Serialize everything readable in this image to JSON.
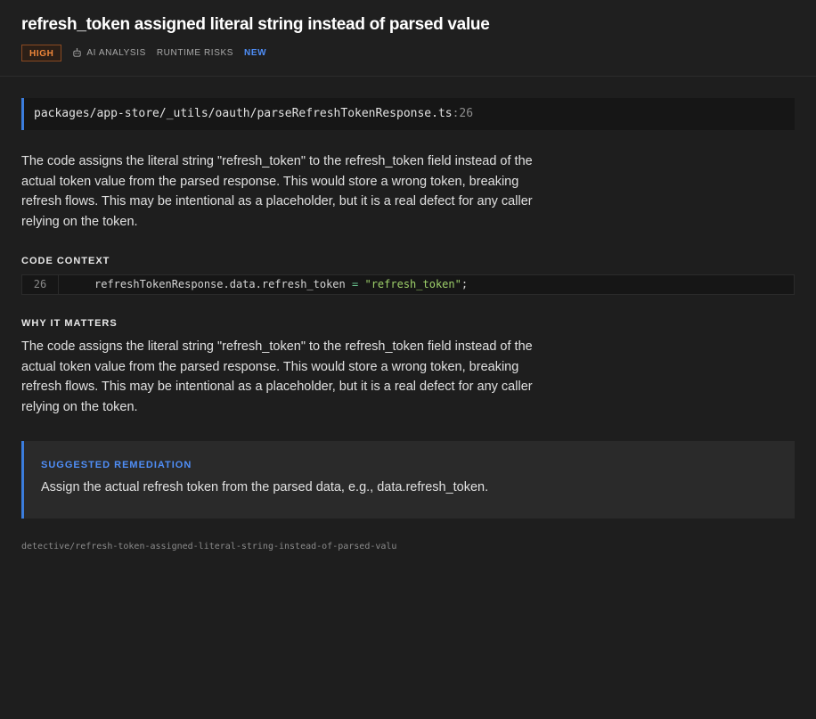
{
  "header": {
    "title": "refresh_token assigned literal string instead of parsed value",
    "severity": "HIGH",
    "tags": {
      "ai_analysis": "AI ANALYSIS",
      "category": "RUNTIME RISKS",
      "status": "NEW"
    },
    "icons": {
      "ai_analysis": "robot-icon"
    }
  },
  "file": {
    "path": "packages/app-store/_utils/oauth/parseRefreshTokenResponse.ts",
    "line_suffix": ":26"
  },
  "description": "The code assigns the literal string \"refresh_token\" to the refresh_token field instead of the actual token value from the parsed response. This would store a wrong token, breaking refresh flows. This may be intentional as a placeholder, but it is a real defect for any caller relying on the token.",
  "code_context": {
    "heading": "CODE CONTEXT",
    "line_number": "26",
    "code": {
      "lhs": "refreshTokenResponse.data.refresh_token",
      "operator": "=",
      "string_literal": "\"refresh_token\"",
      "terminator": ";"
    }
  },
  "why_it_matters": {
    "heading": "WHY IT MATTERS",
    "text": "The code assigns the literal string \"refresh_token\" to the refresh_token field instead of the actual token value from the parsed response. This would store a wrong token, breaking refresh flows. This may be intentional as a placeholder, but it is a real defect for any caller relying on the token."
  },
  "remediation": {
    "heading": "SUGGESTED REMEDIATION",
    "text": "Assign the actual refresh token from the parsed data, e.g., data.refresh_token."
  },
  "slug": "detective/refresh-token-assigned-literal-string-instead-of-parsed-valu",
  "colors": {
    "background": "#1e1e1e",
    "accent_blue": "#3b7ddd",
    "severity_orange": "#f0873a",
    "status_new": "#4f8ef7",
    "code_string": "#9ed06a"
  }
}
